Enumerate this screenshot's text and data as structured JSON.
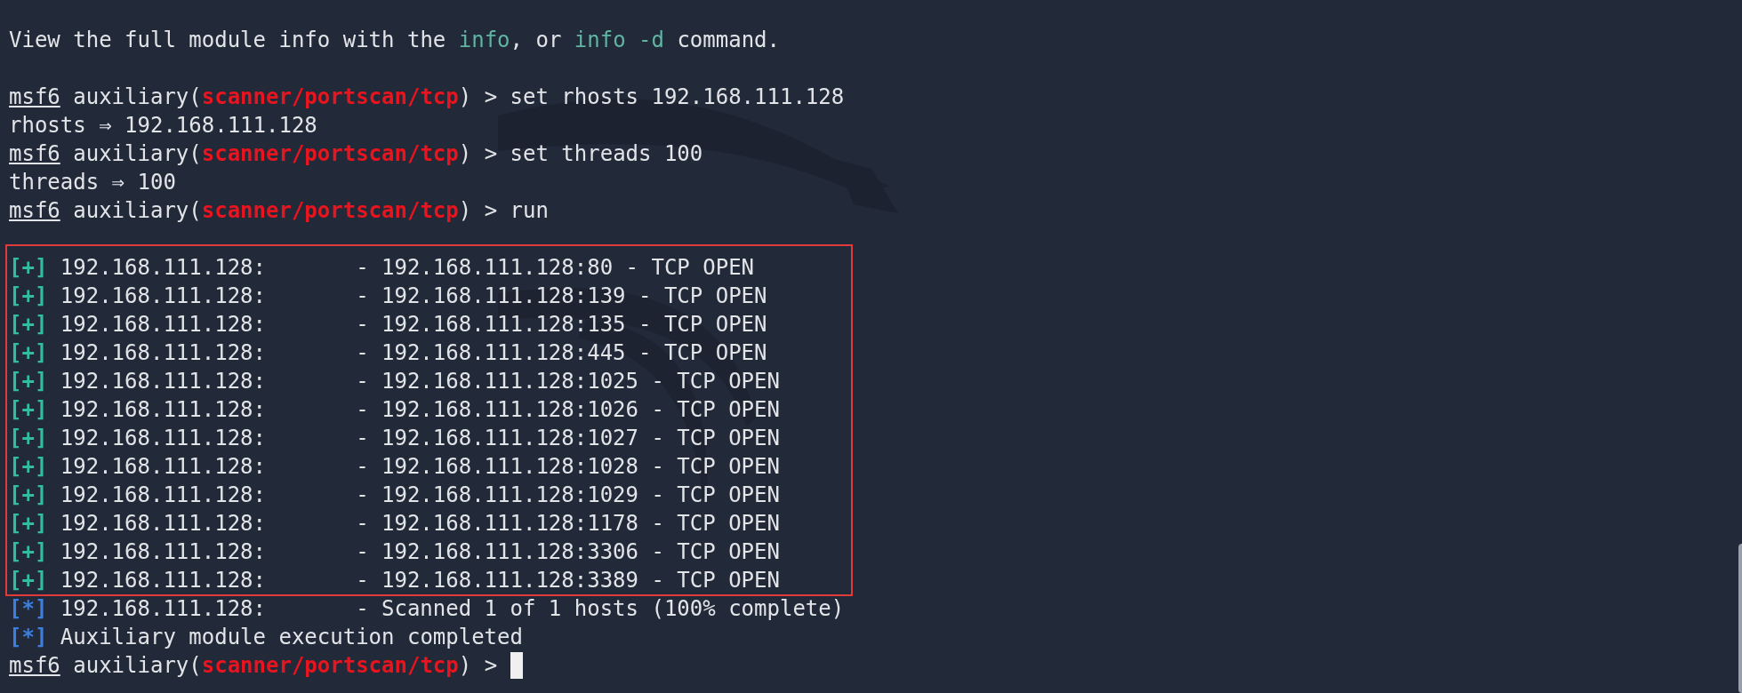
{
  "intro": [
    {
      "kind": "plain",
      "text": "View the full module info with the "
    },
    {
      "kind": "command",
      "text": "info"
    },
    {
      "kind": "plain",
      "text": ", or "
    },
    {
      "kind": "command",
      "text": "info -d"
    },
    {
      "kind": "plain",
      "text": " command."
    }
  ],
  "session": [
    {
      "kind": "prompt",
      "prompt": {
        "user": "msf6",
        "context": "auxiliary(",
        "module": "scanner/portscan/tcp",
        "close": ") >"
      },
      "command": "set rhosts 192.168.111.128"
    },
    {
      "kind": "output",
      "text": "rhosts ⇒ 192.168.111.128"
    },
    {
      "kind": "prompt",
      "prompt": {
        "user": "msf6",
        "context": "auxiliary(",
        "module": "scanner/portscan/tcp",
        "close": ") >"
      },
      "command": "set threads 100"
    },
    {
      "kind": "output",
      "text": "threads ⇒ 100"
    },
    {
      "kind": "prompt",
      "prompt": {
        "user": "msf6",
        "context": "auxiliary(",
        "module": "scanner/portscan/tcp",
        "close": ") >"
      },
      "command": "run"
    }
  ],
  "scan_results": {
    "highlighted": true,
    "rows": [
      {
        "kind": "success",
        "marker": "[+]",
        "host": "192.168.111.128:",
        "detail": "- 192.168.111.128:80 - TCP OPEN"
      },
      {
        "kind": "success",
        "marker": "[+]",
        "host": "192.168.111.128:",
        "detail": "- 192.168.111.128:139 - TCP OPEN"
      },
      {
        "kind": "success",
        "marker": "[+]",
        "host": "192.168.111.128:",
        "detail": "- 192.168.111.128:135 - TCP OPEN"
      },
      {
        "kind": "success",
        "marker": "[+]",
        "host": "192.168.111.128:",
        "detail": "- 192.168.111.128:445 - TCP OPEN"
      },
      {
        "kind": "success",
        "marker": "[+]",
        "host": "192.168.111.128:",
        "detail": "- 192.168.111.128:1025 - TCP OPEN"
      },
      {
        "kind": "success",
        "marker": "[+]",
        "host": "192.168.111.128:",
        "detail": "- 192.168.111.128:1026 - TCP OPEN"
      },
      {
        "kind": "success",
        "marker": "[+]",
        "host": "192.168.111.128:",
        "detail": "- 192.168.111.128:1027 - TCP OPEN"
      },
      {
        "kind": "success",
        "marker": "[+]",
        "host": "192.168.111.128:",
        "detail": "- 192.168.111.128:1028 - TCP OPEN"
      },
      {
        "kind": "success",
        "marker": "[+]",
        "host": "192.168.111.128:",
        "detail": "- 192.168.111.128:1029 - TCP OPEN"
      },
      {
        "kind": "success",
        "marker": "[+]",
        "host": "192.168.111.128:",
        "detail": "- 192.168.111.128:1178 - TCP OPEN"
      },
      {
        "kind": "success",
        "marker": "[+]",
        "host": "192.168.111.128:",
        "detail": "- 192.168.111.128:3306 - TCP OPEN"
      },
      {
        "kind": "success",
        "marker": "[+]",
        "host": "192.168.111.128:",
        "detail": "- 192.168.111.128:3389 - TCP OPEN"
      }
    ]
  },
  "summary": [
    {
      "kind": "info",
      "marker": "[*]",
      "host": "192.168.111.128:",
      "detail": "- Scanned 1 of 1 hosts (100% complete)"
    },
    {
      "kind": "info",
      "marker": "[*]",
      "text": "Auxiliary module execution completed"
    }
  ],
  "final_prompt": {
    "prompt": {
      "user": "msf6",
      "context": "auxiliary(",
      "module": "scanner/portscan/tcp",
      "close": ") >"
    },
    "cursor": true
  }
}
